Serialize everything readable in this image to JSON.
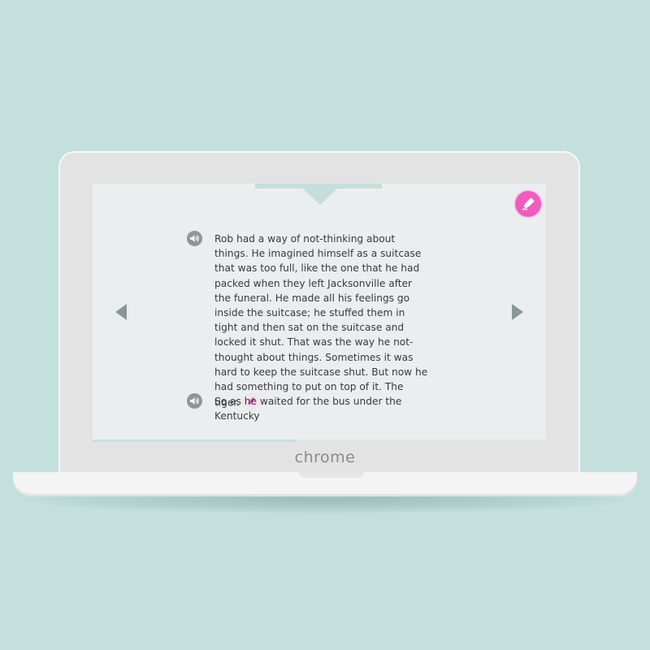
{
  "device": {
    "brand_label": "chrome"
  },
  "reader": {
    "paragraphs": [
      {
        "text": "Rob had a way of not-thinking about things. He imagined himself as a suitcase that was too full, like the one that he had packed when they left Jacksonville after the funeral. He made all his feelings go inside the suitcase; he stuffed them in tight and then sat on the suitcase and locked it shut. That was the way he not-thought about things. Sometimes it was hard to keep the suitcase shut. But now he had something to put on top of it. The tiger."
      },
      {
        "text": "So as he waited for the bus under the Kentucky"
      }
    ],
    "reading_progress": 0.45,
    "icons": {
      "audio": "speaker-icon",
      "highlight": "highlighter-icon",
      "prev": "chevron-left-icon",
      "next": "chevron-right-icon"
    }
  },
  "colors": {
    "background": "#c4e0dc",
    "highlight_accent": "#ee5cc0",
    "screen": "#ebeeef",
    "icon_gray": "#8d9896"
  }
}
